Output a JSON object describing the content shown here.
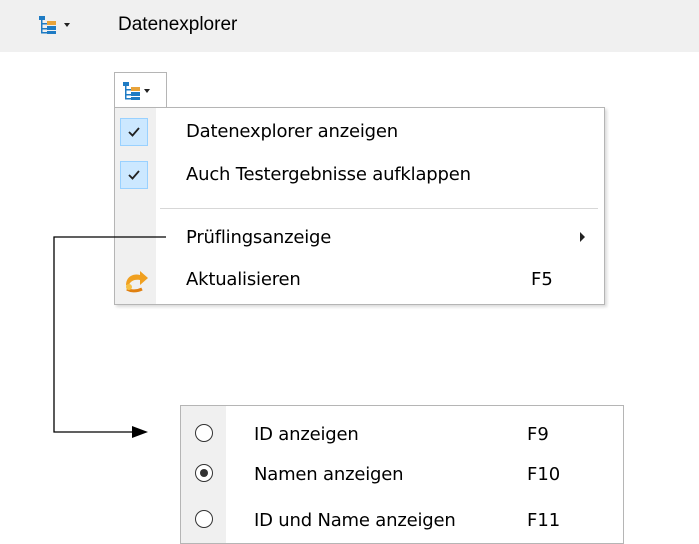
{
  "header": {
    "title": "Datenexplorer",
    "icon": "tree-view-icon"
  },
  "menu": {
    "items": [
      {
        "label": "Datenexplorer anzeigen",
        "checked": true
      },
      {
        "label": "Auch Testergebnisse aufklappen",
        "checked": true
      },
      {
        "label": "Prüflingsanzeige",
        "has_submenu": true
      },
      {
        "label": "Aktualisieren",
        "shortcut": "F5",
        "icon": "refresh-icon"
      }
    ]
  },
  "submenu": {
    "items": [
      {
        "label": "ID anzeigen",
        "shortcut": "F9",
        "selected": false
      },
      {
        "label": "Namen anzeigen",
        "shortcut": "F10",
        "selected": true
      },
      {
        "label": "ID und Name anzeigen",
        "shortcut": "F11",
        "selected": false
      }
    ]
  },
  "colors": {
    "check_bg": "#cce8ff",
    "check_border": "#99d1ff",
    "gutter": "#f0f0f0",
    "tree_icon": "#1e7bc4"
  }
}
